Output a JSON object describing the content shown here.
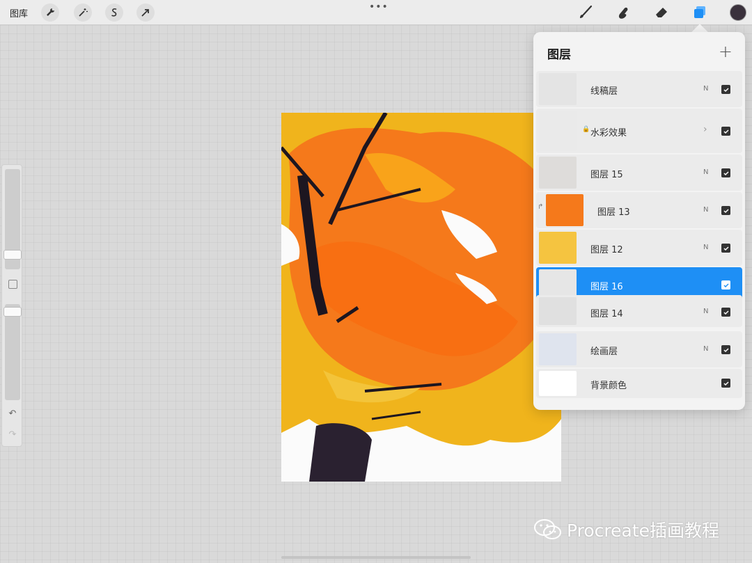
{
  "topbar": {
    "gallery_label": "图库",
    "tools_left": [
      {
        "icon": "wrench-icon"
      },
      {
        "icon": "magic-wand-icon"
      },
      {
        "icon": "selection-icon"
      },
      {
        "icon": "transform-arrow-icon"
      }
    ],
    "menu_dots": "•••",
    "tools_right": [
      {
        "icon": "brush-icon"
      },
      {
        "icon": "smudge-icon"
      },
      {
        "icon": "eraser-icon"
      },
      {
        "icon": "layers-icon",
        "active": true
      }
    ],
    "current_color": "#3a313c",
    "accent_color": "#1e8ff5"
  },
  "sidebar": {
    "undo_glyph": "↶",
    "redo_glyph": "↷"
  },
  "layers": {
    "title": "图层",
    "add_glyph": "+",
    "items": [
      {
        "name": "线稿层",
        "mode": "N",
        "visible": true
      },
      {
        "name": "水彩效果",
        "locked": true,
        "group": true,
        "visible": true
      },
      {
        "name": "图层 15",
        "mode": "N",
        "visible": true
      },
      {
        "name": "图层 13",
        "mode": "N",
        "clipped": true,
        "visible": true
      },
      {
        "name": "图层 12",
        "mode": "N",
        "visible": true
      },
      {
        "name": "图层 16",
        "mode": "",
        "visible": true,
        "selected": true
      },
      {
        "name": "图层 14",
        "mode": "N",
        "visible": true
      },
      {
        "name": "绘画层",
        "mode": "N",
        "visible": true
      },
      {
        "name": "背景颜色",
        "mode": "",
        "visible": true
      }
    ]
  },
  "watermark": {
    "text": "Procreate插画教程",
    "icon": "wechat-logo"
  }
}
